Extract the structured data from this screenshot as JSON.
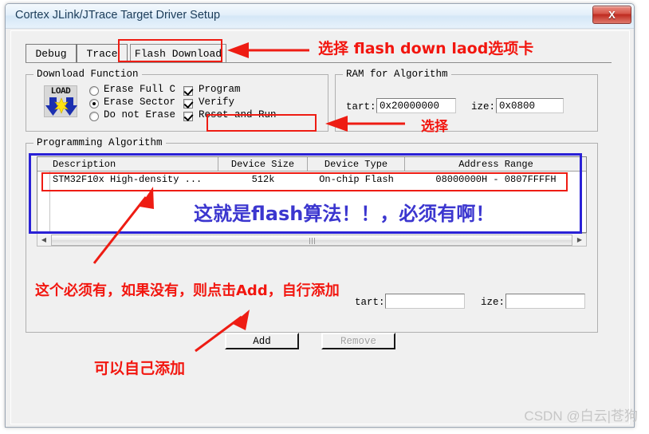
{
  "window": {
    "title": "Cortex JLink/JTrace Target Driver Setup",
    "close_label": "X"
  },
  "tabs": [
    {
      "label": "Debug",
      "selected": false
    },
    {
      "label": "Trace",
      "selected": false
    },
    {
      "label": "Flash Download",
      "selected": true
    }
  ],
  "download_function": {
    "legend": "Download Function",
    "icon_label": "LOAD",
    "radios": [
      {
        "label": "Erase Full C",
        "checked": false
      },
      {
        "label": "Erase Sector",
        "checked": true
      },
      {
        "label": "Do not Erase",
        "checked": false
      }
    ],
    "checkboxes": [
      {
        "label": "Program",
        "checked": true
      },
      {
        "label": "Verify",
        "checked": true
      },
      {
        "label": "Reset and Run",
        "checked": true
      }
    ]
  },
  "ram_for_algorithm": {
    "legend": "RAM for Algorithm",
    "start_label": "tart:",
    "start_value": "0x20000000",
    "size_label": "ize:",
    "size_value": "0x0800"
  },
  "programming_algorithm": {
    "legend": "Programming Algorithm",
    "columns": [
      "Description",
      "Device Size",
      "Device Type",
      "Address Range"
    ],
    "rows": [
      {
        "description": "STM32F10x High-density ...",
        "device_size": "512k",
        "device_type": "On-chip Flash",
        "address_range": "08000000H - 0807FFFFH"
      }
    ],
    "start_label": "tart:",
    "start_value": "",
    "size_label": "ize:",
    "size_value": "",
    "add_label": "Add",
    "remove_label": "Remove"
  },
  "annotations": {
    "tab_note": "选择 flash down laod选项卡",
    "reset_note": "选择",
    "table_note": "这就是flash算法！！，必须有啊！",
    "must_have_note": "这个必须有，如果没有，则点击Add，自行添加",
    "add_note": "可以自己添加"
  },
  "watermark": "CSDN @白云|苍狗",
  "colors": {
    "annotation_red": "#f2160f",
    "annotation_blue": "#3b36cf",
    "highlight_box_red": "#ee1c13",
    "highlight_box_blue": "#2a21d6",
    "title_text": "#1b3c59"
  }
}
